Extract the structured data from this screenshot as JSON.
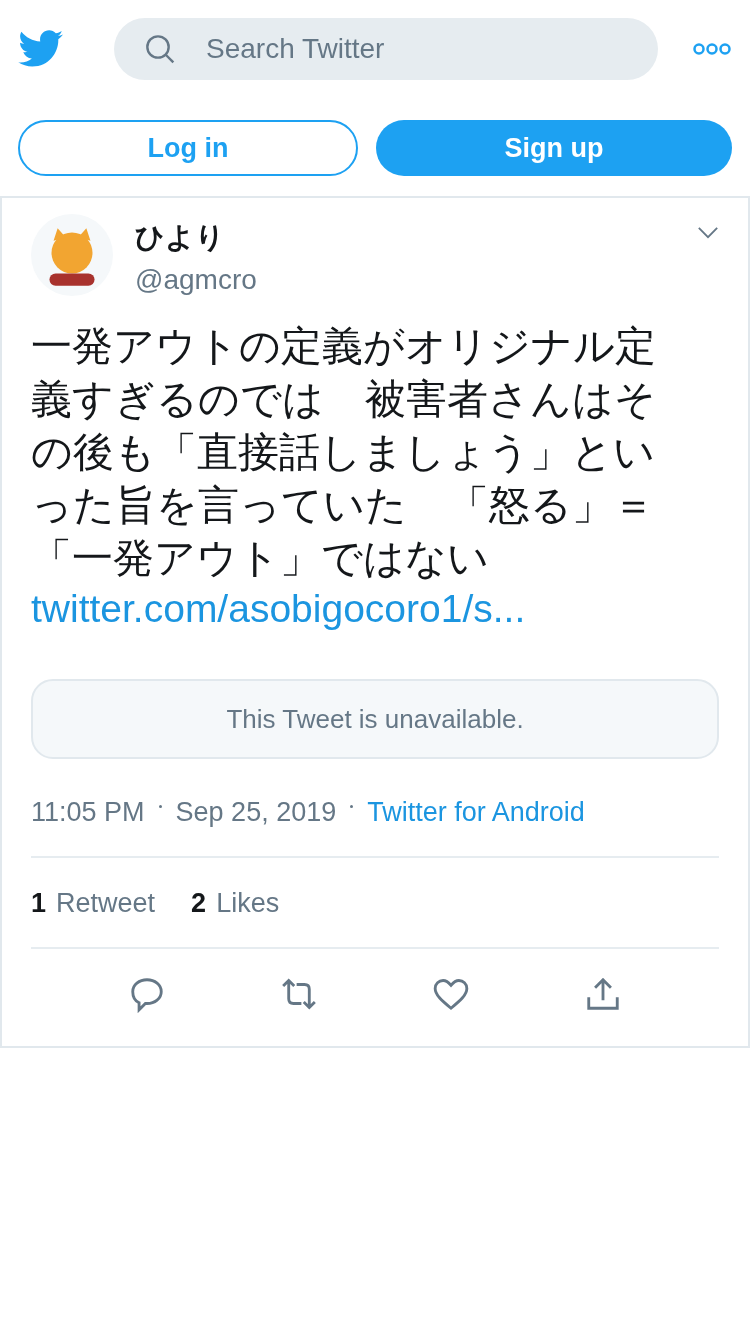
{
  "header": {
    "search": {
      "placeholder": "Search Twitter"
    }
  },
  "auth_buttons": [
    {
      "label": "Log in",
      "kind": "outline"
    },
    {
      "label": "Sign up",
      "kind": "filled"
    }
  ],
  "tweet": {
    "name": "ひより",
    "handle": "@agmcro",
    "text": "一発アウトの定義がオリジナル定義すぎるのでは　被害者さんはその後も「直接話しましょう」といった旨を言っていた　「怒る」＝「一発アウト」ではない",
    "link": "twitter.com/asobigocoro1/s...",
    "quoted_notice": "This Tweet is unavailable.",
    "time": "11:05 PM",
    "date": "Sep 25, 2019",
    "source": "Twitter for Android",
    "stats": [
      {
        "count": "1",
        "label": "Retweet"
      },
      {
        "count": "2",
        "label": "Likes"
      }
    ]
  }
}
